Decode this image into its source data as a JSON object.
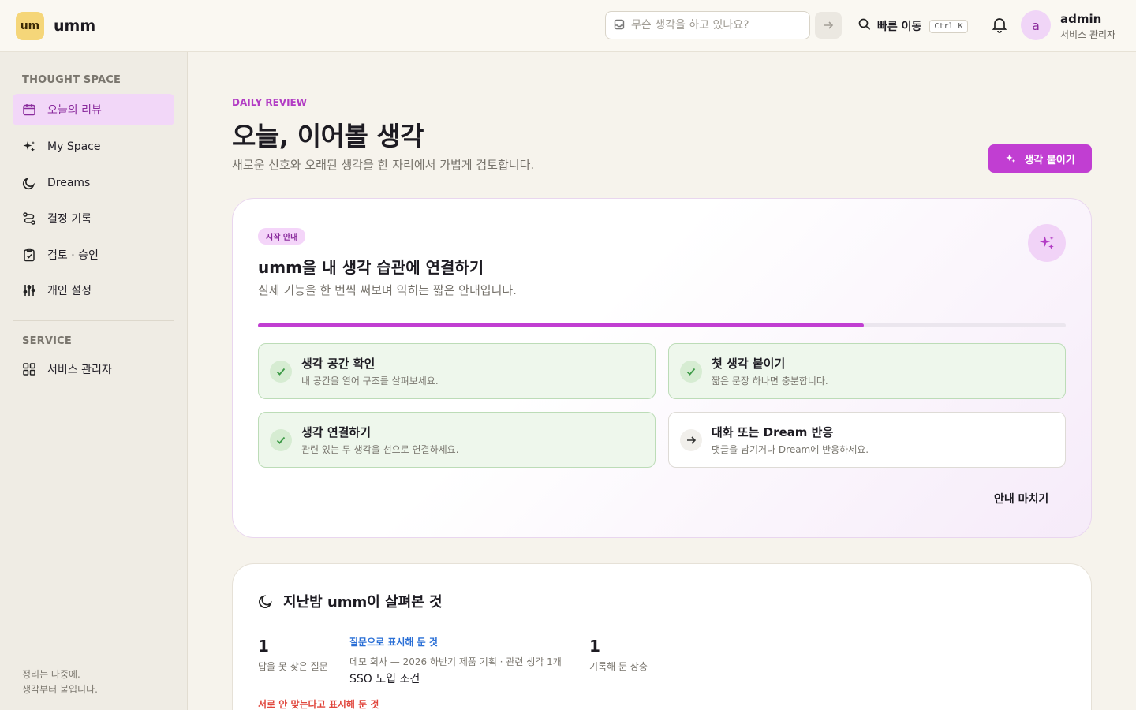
{
  "brand": {
    "logo": "um",
    "name": "umm"
  },
  "header": {
    "composer_placeholder": "무슨 생각을 하고 있나요?",
    "quick_jump_label": "빠른 이동",
    "quick_jump_shortcut": "Ctrl K",
    "user": {
      "initial": "a",
      "name": "admin",
      "role": "서비스 관리자"
    }
  },
  "sidebar": {
    "section1": "THOUGHT SPACE",
    "items": [
      {
        "label": "오늘의 리뷰",
        "icon": "calendar-icon",
        "active": true
      },
      {
        "label": "My Space",
        "icon": "sparkle-icon"
      },
      {
        "label": "Dreams",
        "icon": "moon-icon"
      },
      {
        "label": "결정 기록",
        "icon": "route-icon"
      },
      {
        "label": "검토 · 승인",
        "icon": "clipboard-check-icon"
      },
      {
        "label": "개인 설정",
        "icon": "sliders-icon"
      }
    ],
    "section2": "SERVICE",
    "service_items": [
      {
        "label": "서비스 관리자",
        "icon": "grid-icon"
      }
    ],
    "footer_line1": "정리는 나중에.",
    "footer_line2": "생각부터 붙입니다."
  },
  "main": {
    "eyebrow": "DAILY REVIEW",
    "title": "오늘, 이어볼 생각",
    "subtitle": "새로운 신호와 오래된 생각을 한 자리에서 가볍게 검토합니다.",
    "primary_button": "생각 붙이기",
    "guide": {
      "badge": "시작 안내",
      "title": "umm을 내 생각 습관에 연결하기",
      "subtitle": "실제 기능을 한 번씩 써보며 익히는 짧은 안내입니다.",
      "progress": 0.75,
      "steps": [
        {
          "title": "생각 공간 확인",
          "desc": "내 공간을 열어 구조를 살펴보세요.",
          "done": true
        },
        {
          "title": "첫 생각 붙이기",
          "desc": "짧은 문장 하나면 충분합니다.",
          "done": true
        },
        {
          "title": "생각 연결하기",
          "desc": "관련 있는 두 생각을 선으로 연결하세요.",
          "done": true
        },
        {
          "title": "대화 또는 Dream 반응",
          "desc": "댓글을 남기거나 Dream에 반응하세요.",
          "done": false
        }
      ],
      "finish": "안내 마치기"
    },
    "night": {
      "title": "지난밤 umm이 살펴본 것",
      "unanswered_count": "1",
      "unanswered_label": "답을 못 찾은 질문",
      "question_heading": "질문으로 표시해 둔 것",
      "question_meta": "데모 회사 — 2026 하반기 제품 기획 · 관련 생각 1개",
      "question_title": "SSO 도입 조건",
      "recorded_count": "1",
      "recorded_label": "기록해 둔 상충",
      "conflict_heading": "서로 안 맞는다고 표시해 둔 것"
    }
  },
  "colors": {
    "accent": "#c13ed2",
    "done_bg": "#eef7ec",
    "link_blue": "#2a6fd6",
    "conflict_red": "#e0463c"
  }
}
